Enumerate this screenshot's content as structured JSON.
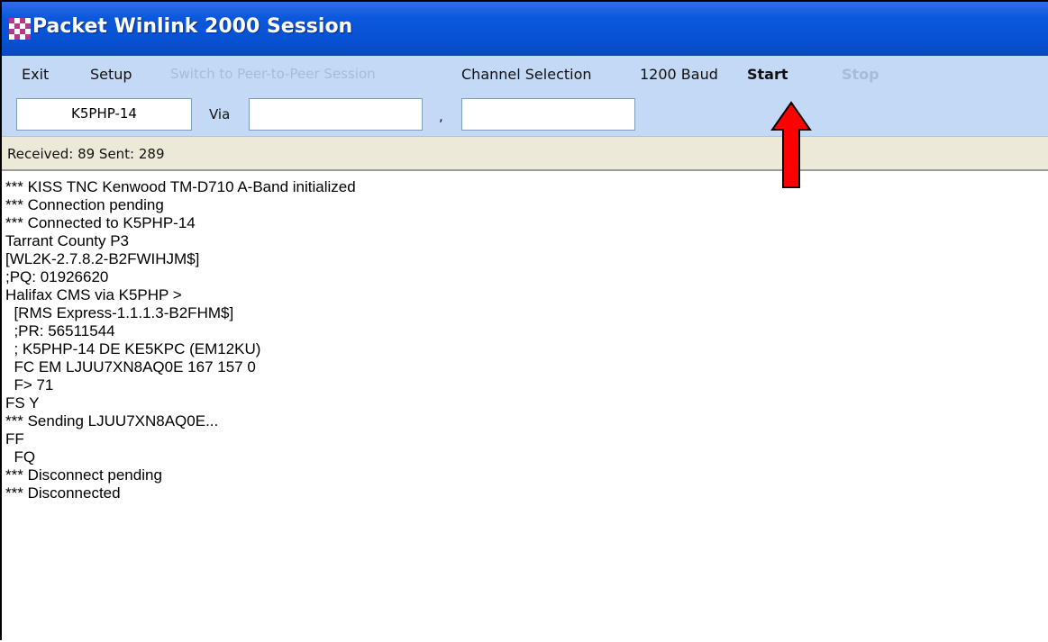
{
  "window": {
    "title": "Packet Winlink 2000 Session"
  },
  "menu": {
    "exit": "Exit",
    "setup": "Setup",
    "peer": "Switch to Peer-to-Peer Session",
    "channel": "Channel Selection",
    "baud": "1200 Baud",
    "start": "Start",
    "stop": "Stop"
  },
  "connect": {
    "callsign": "K5PHP-14",
    "via_label": "Via",
    "via1": "",
    "separator": ",",
    "via2": ""
  },
  "status": {
    "text": "Received: 89  Sent: 289"
  },
  "log": [
    "*** KISS TNC Kenwood TM-D710 A-Band initialized",
    "*** Connection pending",
    "*** Connected to K5PHP-14",
    "Tarrant County P3",
    "[WL2K-2.7.8.2-B2FWIHJM$]",
    ";PQ: 01926620",
    "Halifax CMS via K5PHP >",
    "  [RMS Express-1.1.1.3-B2FHM$]",
    "  ;PR: 56511544",
    "  ; K5PHP-14 DE KE5KPC (EM12KU)",
    "  FC EM LJUU7XN8AQ0E 167 157 0",
    "  F> 71",
    "FS Y",
    "*** Sending LJUU7XN8AQ0E...",
    "FF",
    "  FQ",
    "*** Disconnect pending",
    "*** Disconnected"
  ],
  "colors": {
    "titlebar": "#0a58dc",
    "menubar": "#c3d9f6",
    "arrow": "#ff0000"
  }
}
